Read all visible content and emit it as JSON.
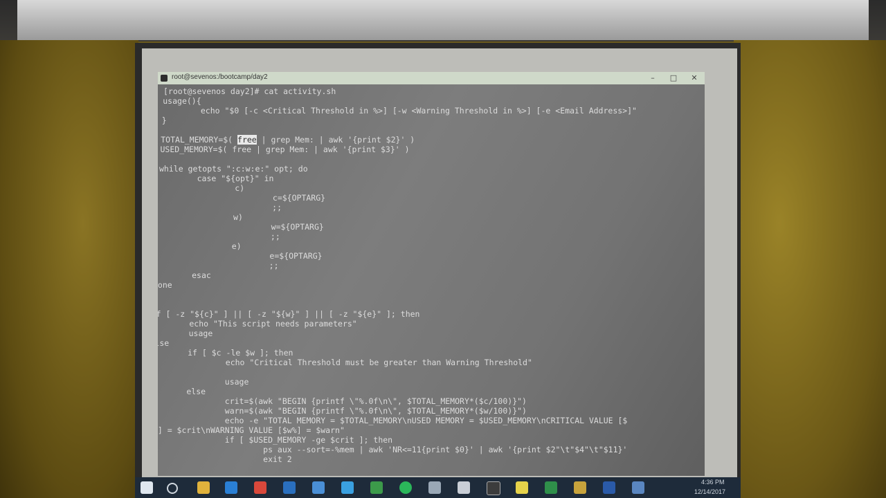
{
  "window": {
    "title": "root@sevenos:/bootcamp/day2",
    "controls": {
      "minimize": "–",
      "maximize": "□",
      "close": "✕"
    }
  },
  "terminal": {
    "lines": [
      "[root@sevenos day2]# cat activity.sh",
      "usage(){",
      "        echo \"$0 [-c <Critical Threshold in %>] [-w <Warning Threshold in %>] [-e <Email Address>]\"",
      "}",
      "",
      "TOTAL_MEMORY=$( free | grep Mem: | awk '{print $2}' )",
      "USED_MEMORY=$( free | grep Mem: | awk '{print $3}' )",
      "",
      "while getopts \":c:w:e:\" opt; do",
      "        case \"${opt}\" in",
      "                c)",
      "                        c=${OPTARG}",
      "                        ;;",
      "                w)",
      "                        w=${OPTARG}",
      "                        ;;",
      "                e)",
      "                        e=${OPTARG}",
      "                        ;;",
      "        esac",
      "done",
      "",
      "",
      "if [ -z \"${c}\" ] || [ -z \"${w}\" ] || [ -z \"${e}\" ]; then",
      "        echo \"This script needs parameters\"",
      "        usage",
      "else",
      "        if [ $c -le $w ]; then",
      "                echo \"Critical Threshold must be greater than Warning Threshold\"",
      "",
      "                usage",
      "        else",
      "                crit=$(awk \"BEGIN {printf \\\"%.0f\\n\\\", $TOTAL_MEMORY*($c/100)}\")",
      "                warn=$(awk \"BEGIN {printf \\\"%.0f\\n\\\", $TOTAL_MEMORY*($w/100)}\")",
      "                echo -e \"TOTAL MEMORY = $TOTAL_MEMORY\\nUSED MEMORY = $USED_MEMORY\\nCRITICAL VALUE [$",
      "c%] = $crit\\nWARNING VALUE [$w%] = $warn\"",
      "                if [ $USED_MEMORY -ge $crit ]; then",
      "                        ps aux --sort=-%mem | awk 'NR<=11{print $0}' | awk '{print $2\"\\t\"$4\"\\t\"$11}'",
      "                        exit 2"
    ],
    "highlight": "free"
  },
  "taskbar": {
    "time": "4:36 PM",
    "date": "12/14/2017"
  }
}
